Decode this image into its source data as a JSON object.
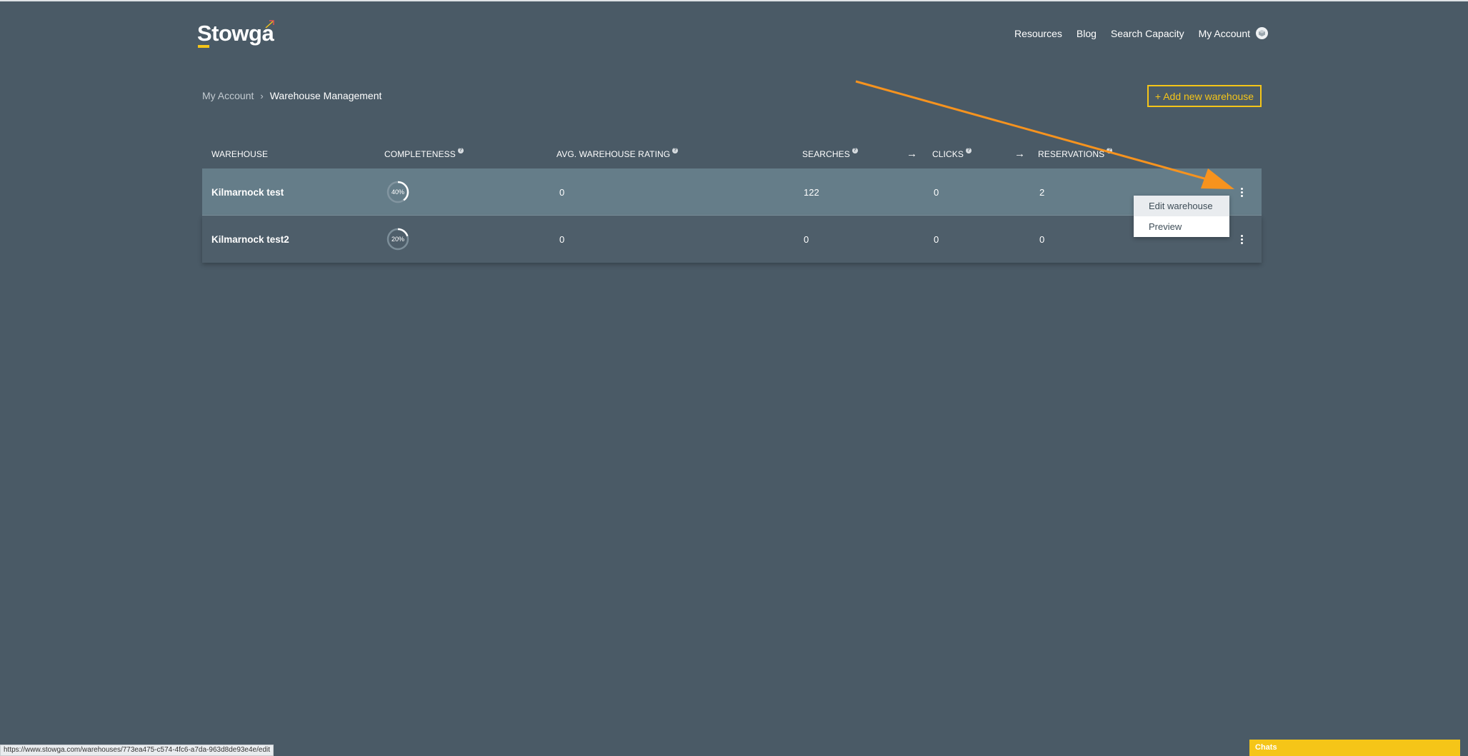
{
  "brand": {
    "logo_text": "Stowga",
    "accent_color": "#f5c518",
    "arrow_color": "#f7931e"
  },
  "nav": {
    "links": [
      "Resources",
      "Blog",
      "Search Capacity"
    ],
    "account_label": "My Account",
    "account_icon": "cube-icon"
  },
  "breadcrumb": {
    "parent": "My Account",
    "current": "Warehouse Management"
  },
  "actions": {
    "add_warehouse": "+ Add new warehouse"
  },
  "table": {
    "headers": {
      "warehouse": "WAREHOUSE",
      "completeness": "COMPLETENESS",
      "rating": "AVG. WAREHOUSE RATING",
      "searches": "SEARCHES",
      "clicks": "CLICKS",
      "reservations": "RESERVATIONS"
    },
    "arrow": "→",
    "rows": [
      {
        "name": "Kilmarnock test",
        "completeness": "40%",
        "completeness_value": 0.4,
        "rating": "0",
        "searches": "122",
        "clicks": "0",
        "reservations": "2"
      },
      {
        "name": "Kilmarnock test2",
        "completeness": "20%",
        "completeness_value": 0.2,
        "rating": "0",
        "searches": "0",
        "clicks": "0",
        "reservations": "0"
      }
    ]
  },
  "row_menu": {
    "items": [
      "Edit warehouse",
      "Preview"
    ]
  },
  "status_url": "https://www.stowga.com/warehouses/773ea475-c574-4fc6-a7da-963d8de93e4e/edit",
  "chat": {
    "label": "Chats"
  }
}
